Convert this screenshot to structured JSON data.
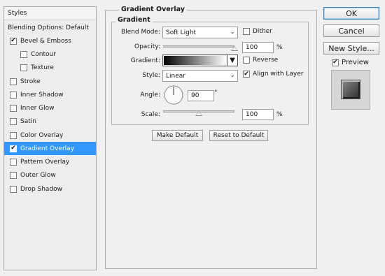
{
  "sidebar": {
    "header": "Styles",
    "items": [
      {
        "label": "Blending Options: Default",
        "checkbox": false
      },
      {
        "label": "Bevel & Emboss",
        "checkbox": true,
        "checked": true
      },
      {
        "label": "Contour",
        "checkbox": true,
        "checked": false,
        "indent": true
      },
      {
        "label": "Texture",
        "checkbox": true,
        "checked": false,
        "indent": true
      },
      {
        "label": "Stroke",
        "checkbox": true,
        "checked": false
      },
      {
        "label": "Inner Shadow",
        "checkbox": true,
        "checked": false
      },
      {
        "label": "Inner Glow",
        "checkbox": true,
        "checked": false
      },
      {
        "label": "Satin",
        "checkbox": true,
        "checked": false
      },
      {
        "label": "Color Overlay",
        "checkbox": true,
        "checked": false
      },
      {
        "label": "Gradient Overlay",
        "checkbox": true,
        "checked": true,
        "selected": true
      },
      {
        "label": "Pattern Overlay",
        "checkbox": true,
        "checked": false
      },
      {
        "label": "Outer Glow",
        "checkbox": true,
        "checked": false
      },
      {
        "label": "Drop Shadow",
        "checkbox": true,
        "checked": false
      }
    ]
  },
  "panel": {
    "title": "Gradient Overlay",
    "subtitle": "Gradient",
    "blend_mode": {
      "label": "Blend Mode:",
      "value": "Soft Light"
    },
    "dither": {
      "label": "Dither",
      "checked": false
    },
    "opacity": {
      "label": "Opacity:",
      "value": "100",
      "unit": "%",
      "level": 1.0
    },
    "gradient": {
      "label": "Gradient:",
      "start_color": "#000000",
      "end_color": "#ffffff"
    },
    "reverse": {
      "label": "Reverse",
      "checked": false
    },
    "style": {
      "label": "Style:",
      "value": "Linear"
    },
    "align_with_layer": {
      "label": "Align with Layer",
      "checked": true
    },
    "angle": {
      "label": "Angle:",
      "value": "90",
      "unit": "°"
    },
    "scale": {
      "label": "Scale:",
      "value": "100",
      "unit": "%",
      "level": 0.5
    },
    "make_default": "Make Default",
    "reset_default": "Reset to Default"
  },
  "right": {
    "ok": "OK",
    "cancel": "Cancel",
    "new_style": "New Style...",
    "preview": {
      "label": "Preview",
      "checked": true
    }
  },
  "colors": {
    "selection": "#3399ff",
    "background": "#f0f0f0"
  }
}
